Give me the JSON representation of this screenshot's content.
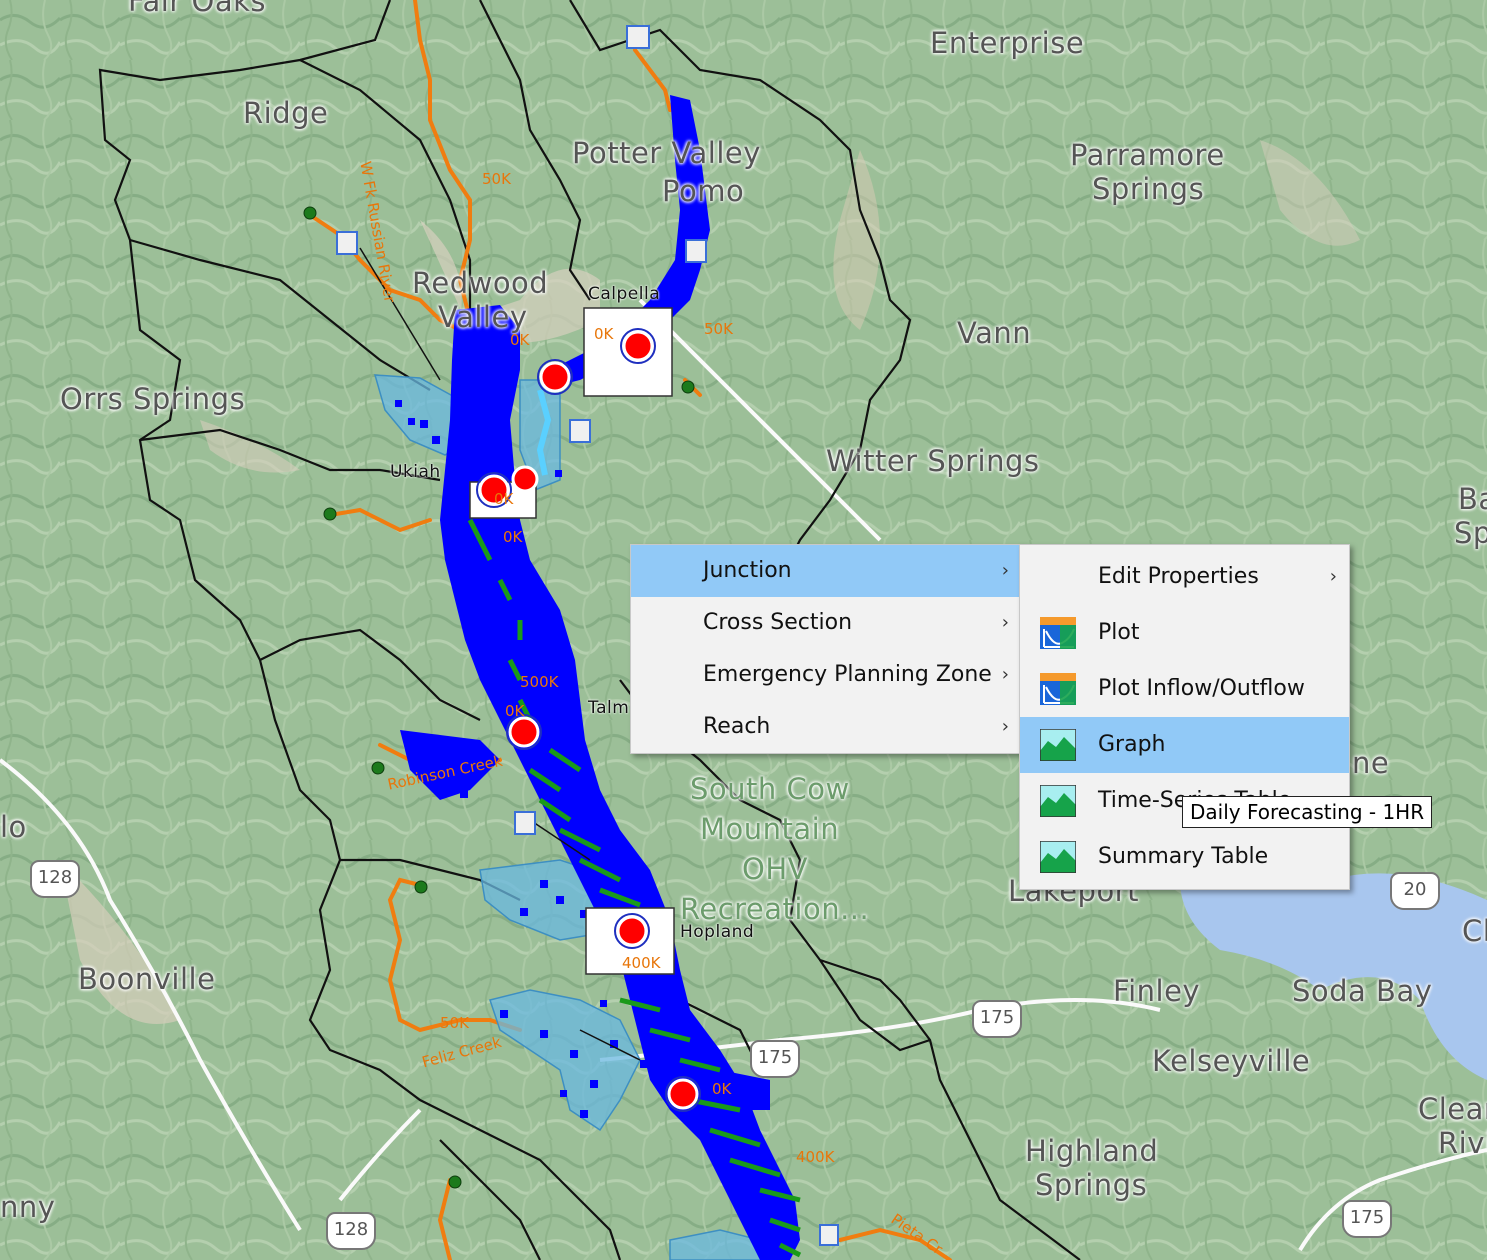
{
  "map": {
    "places": [
      {
        "name": "Fair Oaks"
      },
      {
        "name": "Enterprise"
      },
      {
        "name": "Ridge"
      },
      {
        "name": "Potter Valley"
      },
      {
        "name": "Pomo"
      },
      {
        "name": "Parramore"
      },
      {
        "name": "Springs"
      },
      {
        "name": "Redwood"
      },
      {
        "name": "Valley"
      },
      {
        "name": "Vann"
      },
      {
        "name": "Orrs Springs"
      },
      {
        "name": "Witter Springs"
      },
      {
        "name": "Ba"
      },
      {
        "name": "Sp"
      },
      {
        "name": "lo"
      },
      {
        "name": "South Cow"
      },
      {
        "name": "Mountain"
      },
      {
        "name": "OHV"
      },
      {
        "name": "Recreation..."
      },
      {
        "name": "Lakeport"
      },
      {
        "name": "Boonville"
      },
      {
        "name": "Finley"
      },
      {
        "name": "Soda Bay"
      },
      {
        "name": "Kelseyville"
      },
      {
        "name": "Clearla"
      },
      {
        "name": "Rivie"
      },
      {
        "name": "Highland"
      },
      {
        "name": "Springs"
      },
      {
        "name": "nny"
      },
      {
        "name": "Cl"
      },
      {
        "name": "ne"
      }
    ],
    "small_labels": [
      "Calpella",
      "Ukiah",
      "Hopland",
      "Talm"
    ],
    "flow_labels": [
      "50K",
      "50K",
      "0K",
      "0K",
      "0K",
      "0K",
      "500K",
      "0K",
      "400K",
      "0K",
      "400K",
      "50K"
    ],
    "river_labels": [
      "W Fk Russian River",
      "Robinson Creek",
      "Feliz Creek",
      "Pieta Cr"
    ],
    "highways": [
      "128",
      "128",
      "175",
      "175",
      "175",
      "20"
    ]
  },
  "context_menu": {
    "items": [
      {
        "label": "Junction",
        "has_submenu": true,
        "active": true
      },
      {
        "label": "Cross Section",
        "has_submenu": true
      },
      {
        "label": "Emergency Planning Zone",
        "has_submenu": true
      },
      {
        "label": "Reach",
        "has_submenu": true
      }
    ]
  },
  "submenu": {
    "items": [
      {
        "label": "Edit Properties",
        "icon": "none",
        "has_submenu": true
      },
      {
        "label": "Plot",
        "icon": "plot-icon"
      },
      {
        "label": "Plot Inflow/Outflow",
        "icon": "plot-inflow-outflow-icon"
      },
      {
        "label": "Graph",
        "icon": "graph-icon",
        "active": true
      },
      {
        "label": "Time-Series Table",
        "icon": "time-series-table-icon"
      },
      {
        "label": "Summary Table",
        "icon": "summary-table-icon"
      }
    ]
  },
  "tooltip": {
    "text": "Daily Forecasting - 1HR"
  },
  "colors": {
    "flood": "#0000ff",
    "reach_green": "#1a9a1a",
    "junction": "#ff0000",
    "river": "#f07d10",
    "menu_highlight": "#91c9f7"
  }
}
